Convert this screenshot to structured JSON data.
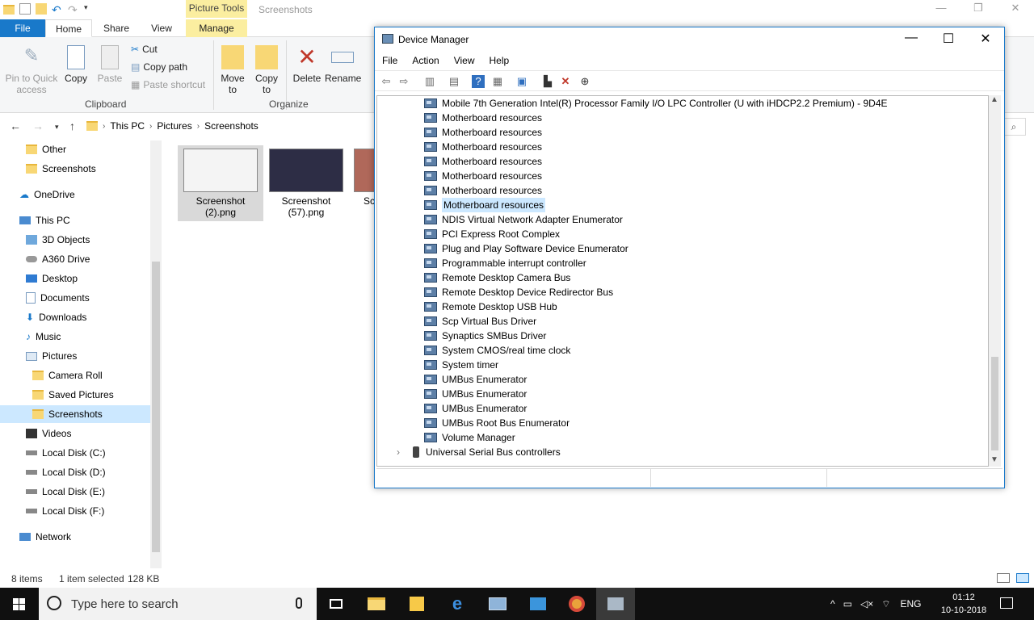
{
  "explorer": {
    "title": "Screenshots",
    "picture_tools": "Picture Tools",
    "tabs": {
      "file": "File",
      "home": "Home",
      "share": "Share",
      "view": "View",
      "manage": "Manage"
    },
    "ribbon": {
      "pin": "Pin to Quick access",
      "pin_l1": "Pin to Quick",
      "pin_l2": "access",
      "copy": "Copy",
      "paste": "Paste",
      "cut": "Cut",
      "copy_path": "Copy path",
      "paste_shortcut": "Paste shortcut",
      "clipboard": "Clipboard",
      "move_l1": "Move",
      "move_l2": "to",
      "copy_to_l1": "Copy",
      "copy_to_l2": "to",
      "delete": "Delete",
      "rename": "Rename",
      "organize": "Organize"
    },
    "breadcrumb": [
      "This PC",
      "Pictures",
      "Screenshots"
    ],
    "nav": [
      {
        "label": "Other"
      },
      {
        "label": "Screenshots"
      },
      {
        "label": "OneDrive"
      },
      {
        "label": "This PC"
      },
      {
        "label": "3D Objects"
      },
      {
        "label": "A360 Drive"
      },
      {
        "label": "Desktop"
      },
      {
        "label": "Documents"
      },
      {
        "label": "Downloads"
      },
      {
        "label": "Music"
      },
      {
        "label": "Pictures"
      },
      {
        "label": "Camera Roll"
      },
      {
        "label": "Saved Pictures"
      },
      {
        "label": "Screenshots"
      },
      {
        "label": "Videos"
      },
      {
        "label": "Local Disk (C:)"
      },
      {
        "label": "Local Disk (D:)"
      },
      {
        "label": "Local Disk (E:)"
      },
      {
        "label": "Local Disk (F:)"
      },
      {
        "label": "Network"
      }
    ],
    "files": [
      {
        "l1": "Screenshot",
        "l2": "(2).png"
      },
      {
        "l1": "Screenshot",
        "l2": "(57).png"
      },
      {
        "l1": "Sc",
        "l2": ""
      }
    ],
    "status": {
      "items": "8 items",
      "selected": "1 item selected",
      "size": "128 KB"
    }
  },
  "devmgr": {
    "title": "Device Manager",
    "menu": [
      "File",
      "Action",
      "View",
      "Help"
    ],
    "devices": [
      "Mobile 7th Generation Intel(R) Processor Family I/O LPC Controller (U with iHDCP2.2 Premium) - 9D4E",
      "Motherboard resources",
      "Motherboard resources",
      "Motherboard resources",
      "Motherboard resources",
      "Motherboard resources",
      "Motherboard resources",
      "Motherboard resources",
      "NDIS Virtual Network Adapter Enumerator",
      "PCI Express Root Complex",
      "Plug and Play Software Device Enumerator",
      "Programmable interrupt controller",
      "Remote Desktop Camera Bus",
      "Remote Desktop Device Redirector Bus",
      "Remote Desktop USB Hub",
      "Scp Virtual Bus Driver",
      "Synaptics SMBus Driver",
      "System CMOS/real time clock",
      "System timer",
      "UMBus Enumerator",
      "UMBus Enumerator",
      "UMBus Enumerator",
      "UMBus Root Bus Enumerator",
      "Volume Manager"
    ],
    "category": "Universal Serial Bus controllers"
  },
  "taskbar": {
    "search_placeholder": "Type here to search",
    "language": "ENG",
    "time": "01:12",
    "date": "10-10-2018"
  },
  "colors": {
    "accent": "#1979ca",
    "selection": "#cce8ff",
    "picture_tools": "#fbeea0",
    "taskbar": "#101010"
  }
}
